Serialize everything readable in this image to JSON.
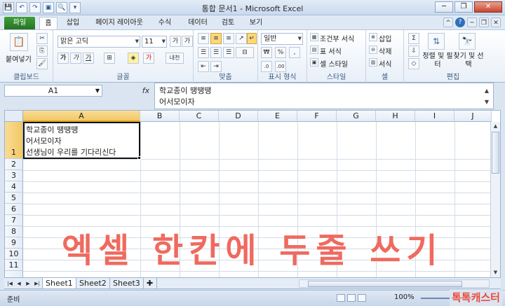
{
  "window": {
    "title": "통합 문서1 - Microsoft Excel",
    "minimize": "─",
    "restore": "❐",
    "close": "✕"
  },
  "qat": [
    "💾",
    "↶",
    "↷",
    "▣",
    "🔍",
    "▾"
  ],
  "tabs": [
    {
      "label": "파일",
      "kind": "file"
    },
    {
      "label": "홈",
      "kind": "active"
    },
    {
      "label": "삽입",
      "kind": "normal"
    },
    {
      "label": "페이지 레이아웃",
      "kind": "normal"
    },
    {
      "label": "수식",
      "kind": "normal"
    },
    {
      "label": "데이터",
      "kind": "normal"
    },
    {
      "label": "검토",
      "kind": "normal"
    },
    {
      "label": "보기",
      "kind": "normal"
    }
  ],
  "ribbon": {
    "clipboard": {
      "label": "클립보드",
      "paste": "붙여넣기"
    },
    "font": {
      "label": "글꼴",
      "name": "맑은 고딕",
      "size": "11",
      "bold": "가",
      "italic": "가",
      "underline": "가",
      "grow": "가",
      "shrink": "가",
      "fontcolor": "가",
      "phonetic": "내천"
    },
    "alignment": {
      "label": "맞춤"
    },
    "number": {
      "label": "표시 형식",
      "format": "일반",
      "percent": "%",
      "comma": ","
    },
    "styles": {
      "label": "스타일",
      "conditional": "조건부 서식",
      "table": "표 서식",
      "cell": "셀 스타일"
    },
    "cells": {
      "label": "셀",
      "insert": "삽입",
      "delete": "삭제",
      "format": "서식"
    },
    "editing": {
      "label": "편집",
      "sum": "Σ",
      "sort": "정렬 및 필터",
      "find": "찾기 및 선택"
    }
  },
  "formula_bar": {
    "name_box": "A1",
    "fx": "fx",
    "lines": [
      "학교종이 땡땡땡",
      "어서모이자"
    ]
  },
  "columns": [
    "A",
    "B",
    "C",
    "D",
    "E",
    "F",
    "G",
    "H",
    "I",
    "J"
  ],
  "rows": [
    "1",
    "2",
    "3",
    "4",
    "5",
    "6",
    "7",
    "8",
    "9",
    "10",
    "11"
  ],
  "cell_a1": [
    "학교종이 땡땡땡",
    "어서모이자",
    "선생님이 우리를 기다리신다"
  ],
  "overlay_text": "엑셀 한칸에 두줄 쓰기",
  "sheets": [
    {
      "label": "Sheet1",
      "active": true
    },
    {
      "label": "Sheet2",
      "active": false
    },
    {
      "label": "Sheet3",
      "active": false
    }
  ],
  "sheet_nav": [
    "|◀",
    "◀",
    "▶",
    "▶|"
  ],
  "status": {
    "ready": "준비",
    "zoom": "100%",
    "zoom_minus": "−",
    "zoom_plus": "+"
  },
  "brand": "톡톡캐스터"
}
